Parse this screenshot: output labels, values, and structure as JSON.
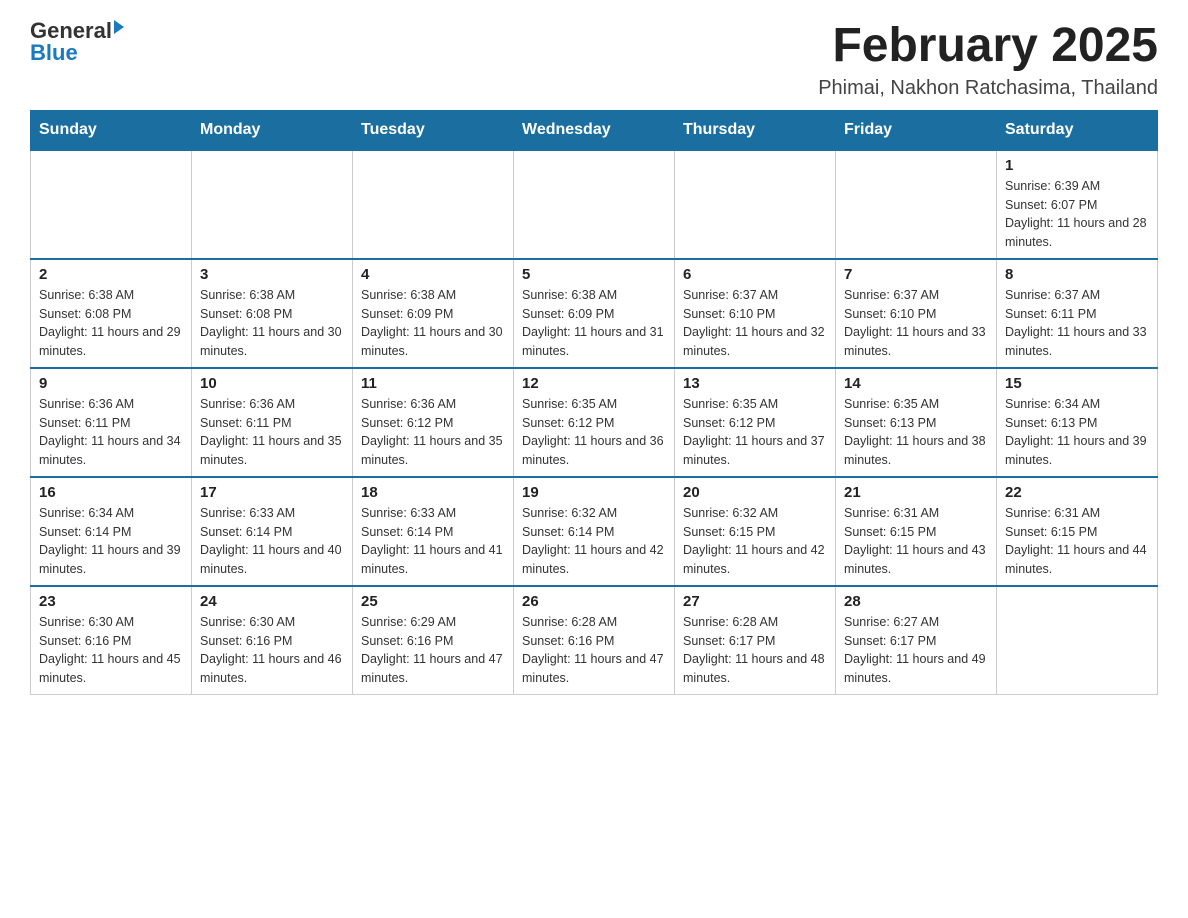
{
  "header": {
    "logo_general": "General",
    "logo_blue": "Blue",
    "month_title": "February 2025",
    "location": "Phimai, Nakhon Ratchasima, Thailand"
  },
  "days_of_week": [
    "Sunday",
    "Monday",
    "Tuesday",
    "Wednesday",
    "Thursday",
    "Friday",
    "Saturday"
  ],
  "weeks": [
    [
      {
        "day": "",
        "info": ""
      },
      {
        "day": "",
        "info": ""
      },
      {
        "day": "",
        "info": ""
      },
      {
        "day": "",
        "info": ""
      },
      {
        "day": "",
        "info": ""
      },
      {
        "day": "",
        "info": ""
      },
      {
        "day": "1",
        "info": "Sunrise: 6:39 AM\nSunset: 6:07 PM\nDaylight: 11 hours and 28 minutes."
      }
    ],
    [
      {
        "day": "2",
        "info": "Sunrise: 6:38 AM\nSunset: 6:08 PM\nDaylight: 11 hours and 29 minutes."
      },
      {
        "day": "3",
        "info": "Sunrise: 6:38 AM\nSunset: 6:08 PM\nDaylight: 11 hours and 30 minutes."
      },
      {
        "day": "4",
        "info": "Sunrise: 6:38 AM\nSunset: 6:09 PM\nDaylight: 11 hours and 30 minutes."
      },
      {
        "day": "5",
        "info": "Sunrise: 6:38 AM\nSunset: 6:09 PM\nDaylight: 11 hours and 31 minutes."
      },
      {
        "day": "6",
        "info": "Sunrise: 6:37 AM\nSunset: 6:10 PM\nDaylight: 11 hours and 32 minutes."
      },
      {
        "day": "7",
        "info": "Sunrise: 6:37 AM\nSunset: 6:10 PM\nDaylight: 11 hours and 33 minutes."
      },
      {
        "day": "8",
        "info": "Sunrise: 6:37 AM\nSunset: 6:11 PM\nDaylight: 11 hours and 33 minutes."
      }
    ],
    [
      {
        "day": "9",
        "info": "Sunrise: 6:36 AM\nSunset: 6:11 PM\nDaylight: 11 hours and 34 minutes."
      },
      {
        "day": "10",
        "info": "Sunrise: 6:36 AM\nSunset: 6:11 PM\nDaylight: 11 hours and 35 minutes."
      },
      {
        "day": "11",
        "info": "Sunrise: 6:36 AM\nSunset: 6:12 PM\nDaylight: 11 hours and 35 minutes."
      },
      {
        "day": "12",
        "info": "Sunrise: 6:35 AM\nSunset: 6:12 PM\nDaylight: 11 hours and 36 minutes."
      },
      {
        "day": "13",
        "info": "Sunrise: 6:35 AM\nSunset: 6:12 PM\nDaylight: 11 hours and 37 minutes."
      },
      {
        "day": "14",
        "info": "Sunrise: 6:35 AM\nSunset: 6:13 PM\nDaylight: 11 hours and 38 minutes."
      },
      {
        "day": "15",
        "info": "Sunrise: 6:34 AM\nSunset: 6:13 PM\nDaylight: 11 hours and 39 minutes."
      }
    ],
    [
      {
        "day": "16",
        "info": "Sunrise: 6:34 AM\nSunset: 6:14 PM\nDaylight: 11 hours and 39 minutes."
      },
      {
        "day": "17",
        "info": "Sunrise: 6:33 AM\nSunset: 6:14 PM\nDaylight: 11 hours and 40 minutes."
      },
      {
        "day": "18",
        "info": "Sunrise: 6:33 AM\nSunset: 6:14 PM\nDaylight: 11 hours and 41 minutes."
      },
      {
        "day": "19",
        "info": "Sunrise: 6:32 AM\nSunset: 6:14 PM\nDaylight: 11 hours and 42 minutes."
      },
      {
        "day": "20",
        "info": "Sunrise: 6:32 AM\nSunset: 6:15 PM\nDaylight: 11 hours and 42 minutes."
      },
      {
        "day": "21",
        "info": "Sunrise: 6:31 AM\nSunset: 6:15 PM\nDaylight: 11 hours and 43 minutes."
      },
      {
        "day": "22",
        "info": "Sunrise: 6:31 AM\nSunset: 6:15 PM\nDaylight: 11 hours and 44 minutes."
      }
    ],
    [
      {
        "day": "23",
        "info": "Sunrise: 6:30 AM\nSunset: 6:16 PM\nDaylight: 11 hours and 45 minutes."
      },
      {
        "day": "24",
        "info": "Sunrise: 6:30 AM\nSunset: 6:16 PM\nDaylight: 11 hours and 46 minutes."
      },
      {
        "day": "25",
        "info": "Sunrise: 6:29 AM\nSunset: 6:16 PM\nDaylight: 11 hours and 47 minutes."
      },
      {
        "day": "26",
        "info": "Sunrise: 6:28 AM\nSunset: 6:16 PM\nDaylight: 11 hours and 47 minutes."
      },
      {
        "day": "27",
        "info": "Sunrise: 6:28 AM\nSunset: 6:17 PM\nDaylight: 11 hours and 48 minutes."
      },
      {
        "day": "28",
        "info": "Sunrise: 6:27 AM\nSunset: 6:17 PM\nDaylight: 11 hours and 49 minutes."
      },
      {
        "day": "",
        "info": ""
      }
    ]
  ]
}
